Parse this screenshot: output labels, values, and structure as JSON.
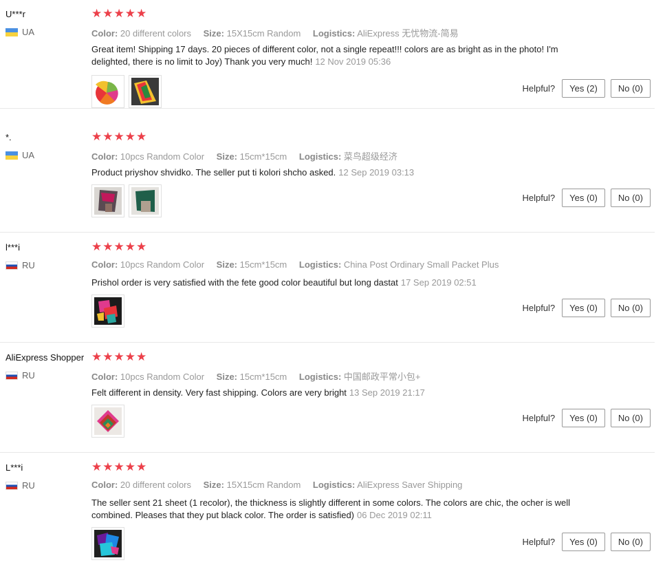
{
  "helpful_label": "Helpful?",
  "labels": {
    "color": "Color:",
    "size": "Size:",
    "logistics": "Logistics:"
  },
  "reviews": [
    {
      "user": "U***r",
      "country": "UA",
      "color": "20 different colors",
      "size": "15X15cm Random",
      "logistics": "AliExpress 无忧物流-简易",
      "feedback": "Great item! Shipping 17 days. 20 pieces of different color, not a single repeat!!! colors are as bright as in the photo! I'm delighted, there is no limit to Joy) Thank you very much!",
      "date": "12 Nov 2019 05:36",
      "yes": "Yes (2)",
      "no": "No (0)"
    },
    {
      "user": "*.",
      "country": "UA",
      "color": "10pcs Random Color",
      "size": "15cm*15cm",
      "logistics": "菜鸟超级经济",
      "feedback": "Product priyshov shvidko. The seller put ti kolori shcho asked.",
      "date": "12 Sep 2019 03:13",
      "yes": "Yes (0)",
      "no": "No (0)"
    },
    {
      "user": "l***i",
      "country": "RU",
      "color": "10pcs Random Color",
      "size": "15cm*15cm",
      "logistics": "China Post Ordinary Small Packet Plus",
      "feedback": "Prishol order is very satisfied with the fete good color beautiful but long dastat",
      "date": "17 Sep 2019 02:51",
      "yes": "Yes (0)",
      "no": "No (0)"
    },
    {
      "user": "AliExpress Shopper",
      "country": "RU",
      "color": "10pcs Random Color",
      "size": "15cm*15cm",
      "logistics": "中国邮政平常小包+",
      "feedback": "Felt different in density. Very fast shipping. Colors are very bright",
      "date": "13 Sep 2019 21:17",
      "yes": "Yes (0)",
      "no": "No (0)"
    },
    {
      "user": "L***i",
      "country": "RU",
      "color": "20 different colors",
      "size": "15X15cm Random",
      "logistics": "AliExpress Saver Shipping",
      "feedback": "The seller sent 21 sheet (1 recolor), the thickness is slightly different in some colors. The colors are chic, the ocher is well combined. Pleases that they put black color. The order is satisfied)",
      "date": "06 Dec 2019 02:11",
      "yes": "Yes (0)",
      "no": "No (0)"
    }
  ]
}
